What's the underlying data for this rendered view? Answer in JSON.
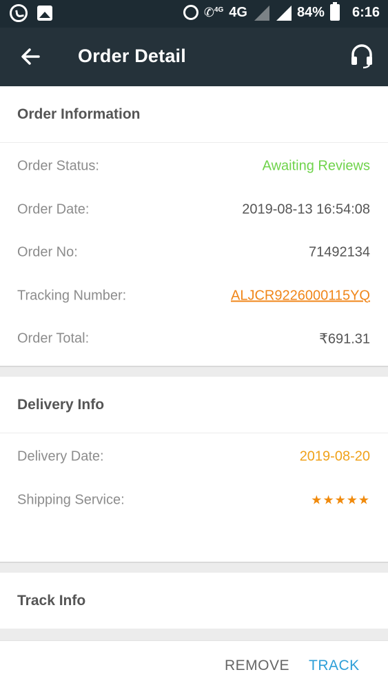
{
  "status_bar": {
    "network": "4G",
    "network_small": "4G",
    "battery": "84%",
    "time": "6:16"
  },
  "app_bar": {
    "title": "Order Detail",
    "back_icon": "arrow-left-icon",
    "support_icon": "headset-icon"
  },
  "order_info": {
    "title": "Order Information",
    "rows": [
      {
        "label": "Order Status:",
        "value": "Awaiting Reviews"
      },
      {
        "label": "Order Date:",
        "value": "2019-08-13 16:54:08"
      },
      {
        "label": "Order No:",
        "value": "71492134"
      },
      {
        "label": "Tracking Number:",
        "value": "ALJCR9226000115YQ"
      },
      {
        "label": "Order Total:",
        "value": "₹691.31"
      }
    ]
  },
  "delivery_info": {
    "title": "Delivery Info",
    "rows": [
      {
        "label": "Delivery Date:",
        "value": "2019-08-20"
      },
      {
        "label": "Shipping Service:",
        "rating": 5,
        "rating_max": 5
      }
    ]
  },
  "track_info": {
    "title": "Track Info"
  },
  "actions": {
    "remove_label": "REMOVE",
    "track_label": "TRACK"
  },
  "colors": {
    "app_bar": "#25323a",
    "status_green": "#6fd34b",
    "date_orange": "#f0a21a",
    "link_orange": "#f0861a",
    "star_orange": "#f08a0c",
    "track_blue": "#2d9fd8"
  }
}
